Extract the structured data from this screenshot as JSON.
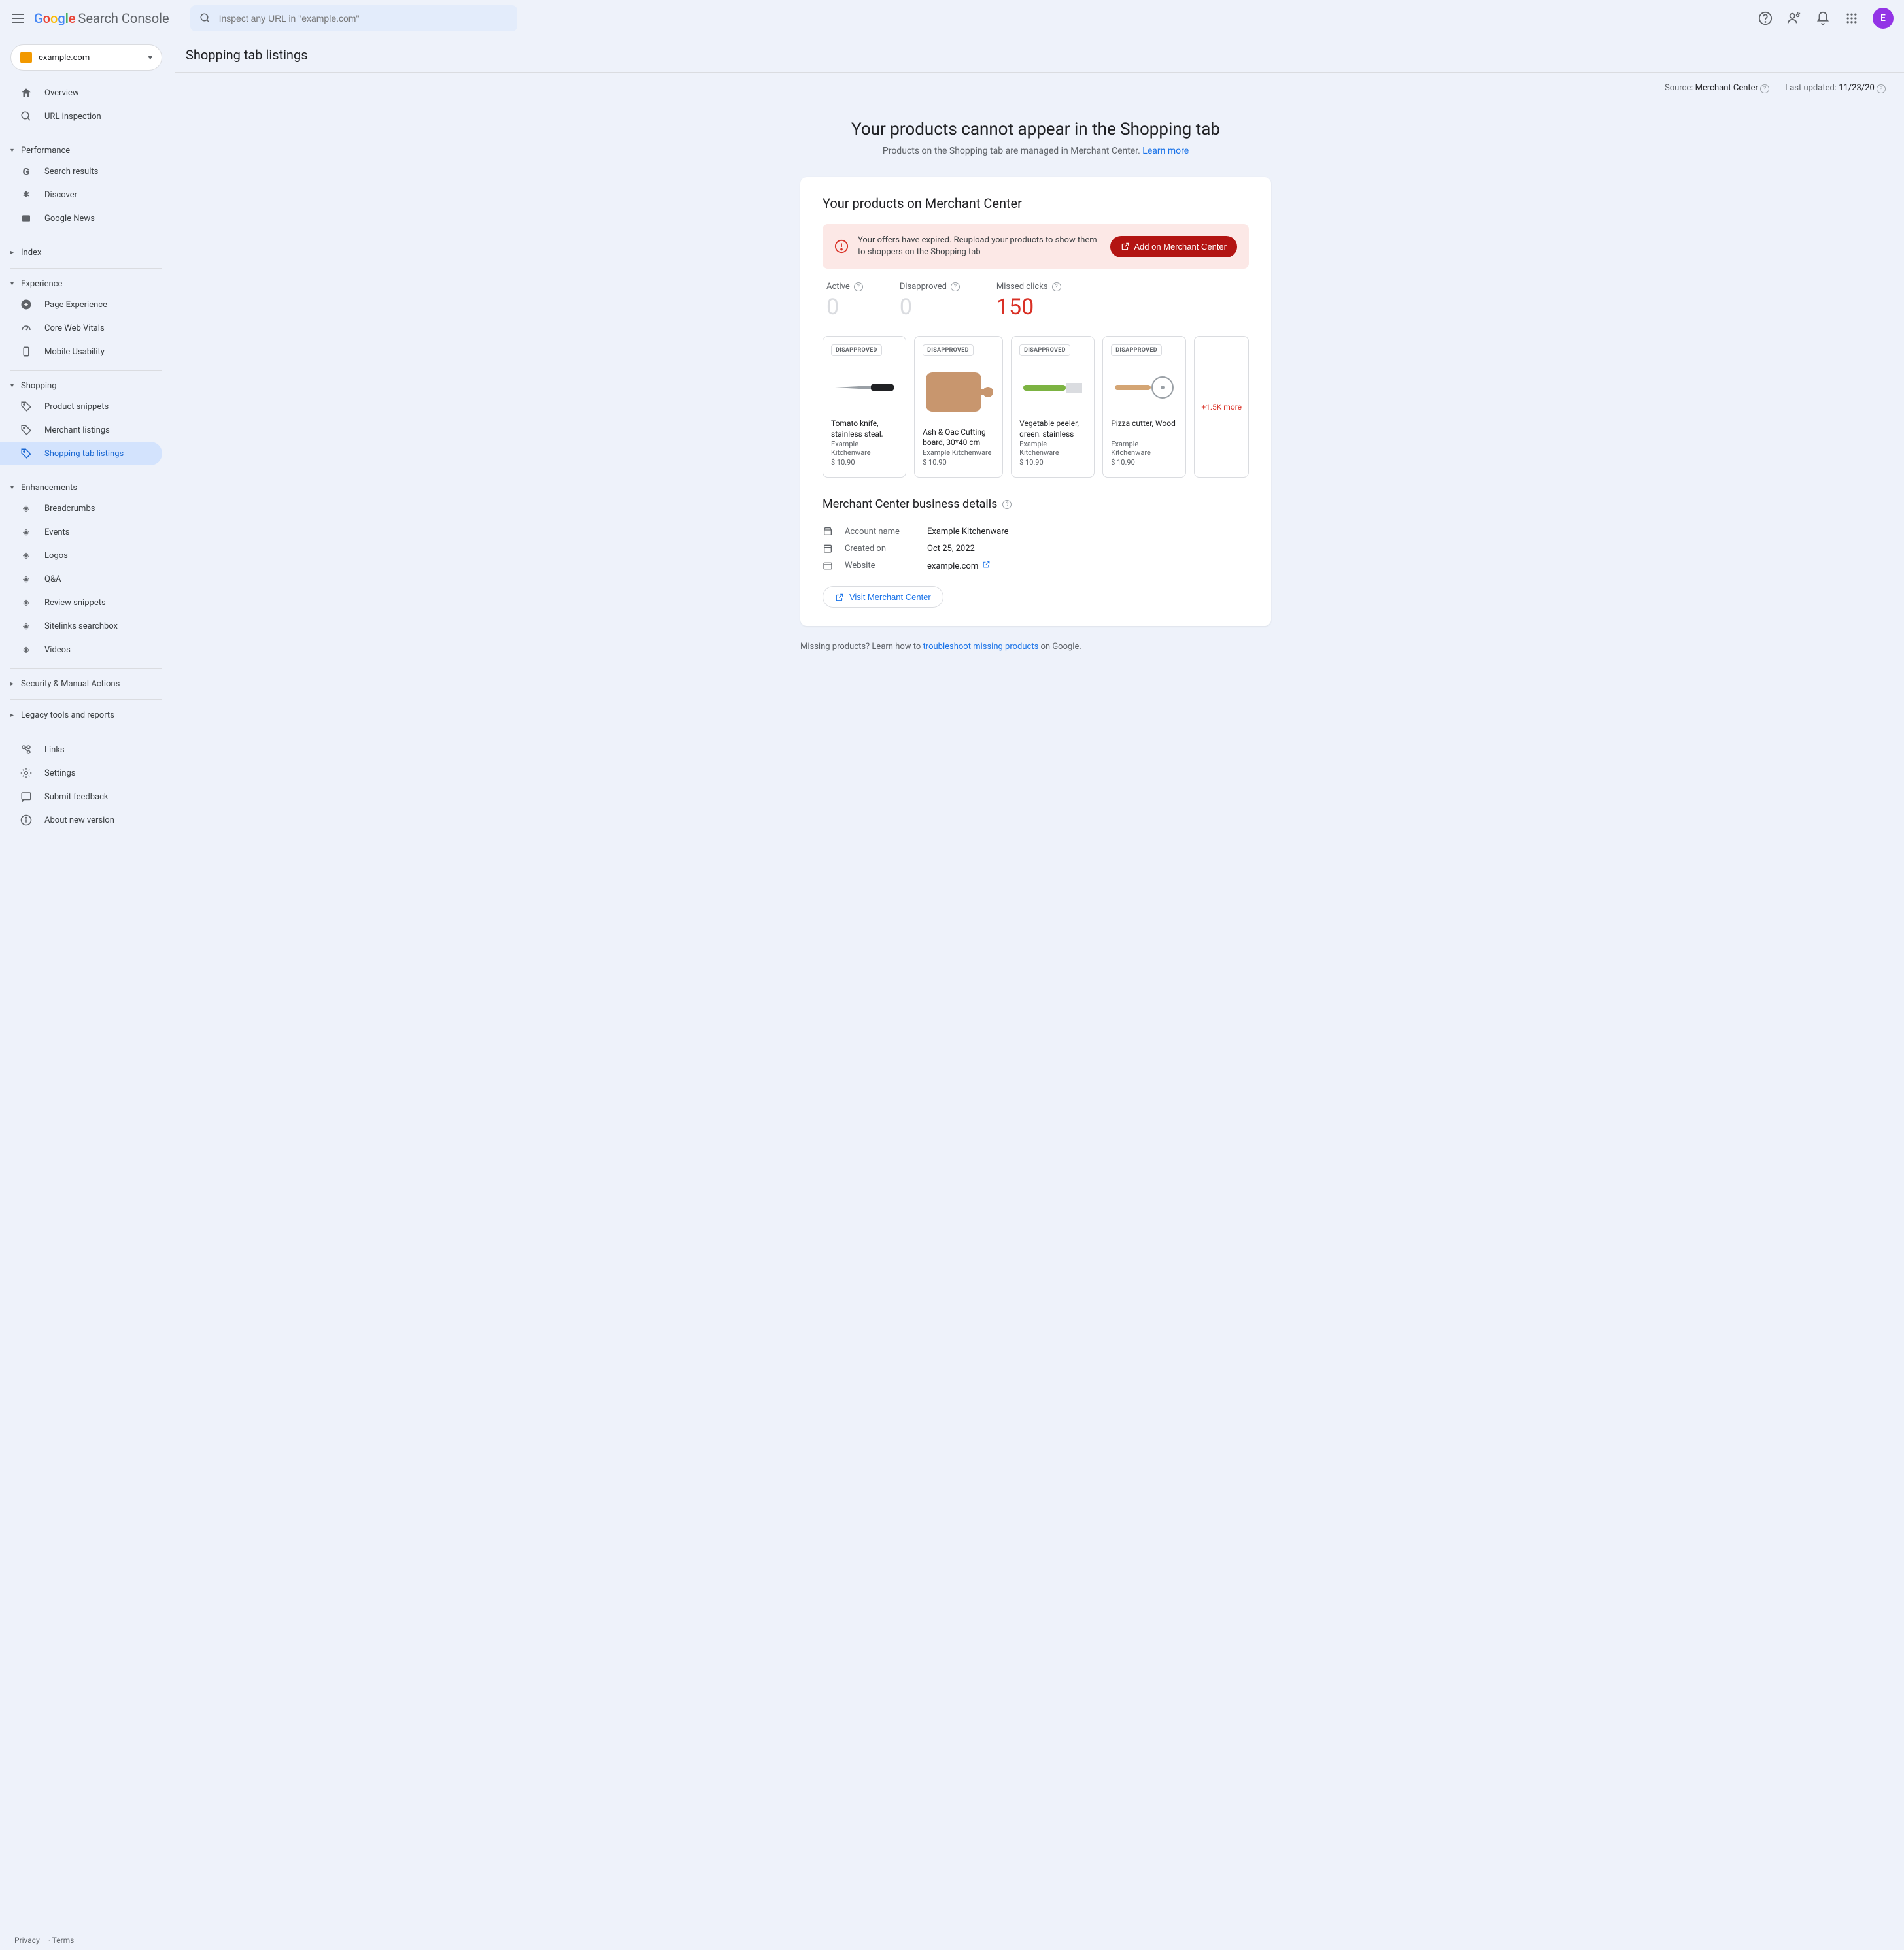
{
  "app_name": "Search Console",
  "search_placeholder": "Inspect any URL in \"example.com\"",
  "avatar_initial": "E",
  "property": "example.com",
  "sidebar": {
    "overview": "Overview",
    "url_inspection": "URL inspection",
    "sections": {
      "performance": {
        "label": "Performance",
        "items": [
          "Search results",
          "Discover",
          "Google News"
        ]
      },
      "index": {
        "label": "Index"
      },
      "experience": {
        "label": "Experience",
        "items": [
          "Page Experience",
          "Core Web Vitals",
          "Mobile Usability"
        ]
      },
      "shopping": {
        "label": "Shopping",
        "items": [
          "Product snippets",
          "Merchant listings",
          "Shopping tab listings"
        ]
      },
      "enhancements": {
        "label": "Enhancements",
        "items": [
          "Breadcrumbs",
          "Events",
          "Logos",
          "Q&A",
          "Review snippets",
          "Sitelinks searchbox",
          "Videos"
        ]
      },
      "security": {
        "label": "Security & Manual Actions"
      },
      "legacy": {
        "label": "Legacy tools and reports"
      }
    },
    "bottom": [
      "Links",
      "Settings",
      "Submit feedback",
      "About new version"
    ]
  },
  "footer": {
    "privacy": "Privacy",
    "terms": "Terms"
  },
  "page": {
    "title": "Shopping tab listings",
    "source_label": "Source:",
    "source_value": "Merchant Center",
    "updated_label": "Last updated:",
    "updated_value": "11/23/20",
    "hero_title": "Your products cannot appear in the Shopping tab",
    "hero_sub": "Products on the Shopping tab are managed in Merchant Center. ",
    "hero_link": "Learn more"
  },
  "card": {
    "title": "Your products on Merchant Center",
    "alert_text": "Your offers have expired. Reupload your products to show them to shoppers on the Shopping tab",
    "alert_button": "Add on Merchant Center",
    "stats": [
      {
        "label": "Active",
        "value": "0",
        "style": "grey"
      },
      {
        "label": "Disapproved",
        "value": "0",
        "style": "grey"
      },
      {
        "label": "Missed clicks",
        "value": "150",
        "style": "red"
      }
    ],
    "products": [
      {
        "badge": "DISAPPROVED",
        "name": "Tomato knife, stainless steal, black",
        "store": "Example Kitchenware",
        "price": "$ 10.90"
      },
      {
        "badge": "DISAPPROVED",
        "name": "Ash & Oac Cutting board, 30*40 cm",
        "store": "Example Kitchenware",
        "price": "$ 10.90"
      },
      {
        "badge": "DISAPPROVED",
        "name": "Vegetable peeler, green, stainless ste...",
        "store": "Example Kitchenware",
        "price": "$ 10.90"
      },
      {
        "badge": "DISAPPROVED",
        "name": "Pizza cutter, Wood",
        "store": "Example Kitchenware",
        "price": "$ 10.90"
      }
    ],
    "more": "+1.5K more",
    "details_title": "Merchant Center business details",
    "details": {
      "account_label": "Account name",
      "account_value": "Example Kitchenware",
      "created_label": "Created on",
      "created_value": "Oct 25, 2022",
      "website_label": "Website",
      "website_value": "example.com"
    },
    "visit_button": "Visit Merchant Center"
  },
  "footnote": {
    "pre": "Missing products? Learn how to ",
    "link": "troubleshoot missing products",
    "post": " on Google."
  }
}
